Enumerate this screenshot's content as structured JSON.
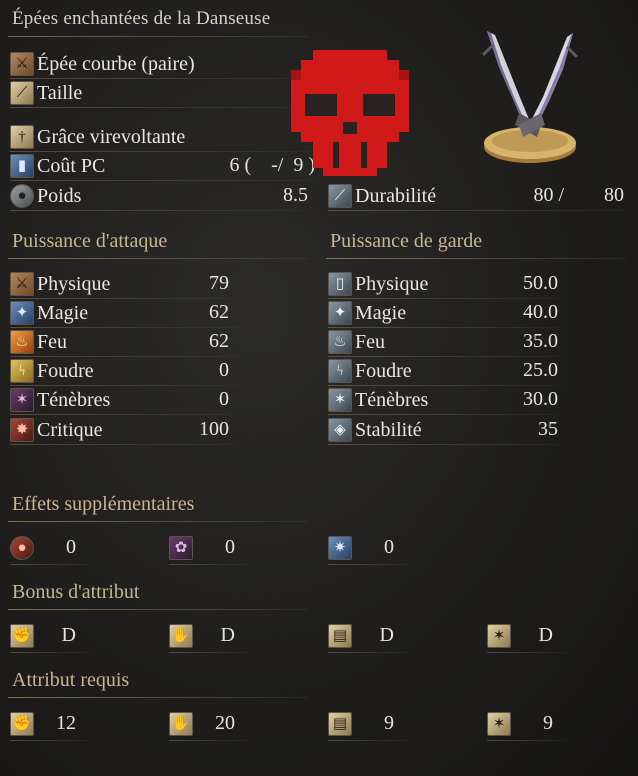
{
  "item": {
    "name": "Épées enchantées de la Danseuse",
    "weapon_type": "Épée courbe (paire)",
    "attack_type": "Taille",
    "skill": "Grâce virevoltante",
    "fp_cost": {
      "label": "Coût PC",
      "value": "6 (    -/  9 )"
    },
    "weight": {
      "label": "Poids",
      "value": "8.5"
    },
    "durability": {
      "label": "Durabilité",
      "current": "80 /",
      "max": "80"
    }
  },
  "attack_power": {
    "heading": "Puissance d'attaque",
    "rows": [
      {
        "label": "Physique",
        "value": "79",
        "icon": "physical-attack-icon"
      },
      {
        "label": "Magie",
        "value": "62",
        "icon": "magic-attack-icon"
      },
      {
        "label": "Feu",
        "value": "62",
        "icon": "fire-attack-icon"
      },
      {
        "label": "Foudre",
        "value": "0",
        "icon": "lightning-attack-icon"
      },
      {
        "label": "Ténèbres",
        "value": "0",
        "icon": "dark-attack-icon"
      },
      {
        "label": "Critique",
        "value": "100",
        "icon": "critical-icon"
      }
    ]
  },
  "guard": {
    "heading": "Puissance de garde",
    "rows": [
      {
        "label": "Physique",
        "value": "50.0",
        "icon": "physical-guard-icon"
      },
      {
        "label": "Magie",
        "value": "40.0",
        "icon": "magic-guard-icon"
      },
      {
        "label": "Feu",
        "value": "35.0",
        "icon": "fire-guard-icon"
      },
      {
        "label": "Foudre",
        "value": "25.0",
        "icon": "lightning-guard-icon"
      },
      {
        "label": "Ténèbres",
        "value": "30.0",
        "icon": "dark-guard-icon"
      },
      {
        "label": "Stabilité",
        "value": "35",
        "icon": "stability-icon"
      }
    ]
  },
  "effects": {
    "heading": "Effets supplémentaires",
    "items": [
      {
        "value": "0",
        "icon": "bleed-icon"
      },
      {
        "value": "0",
        "icon": "poison-icon"
      },
      {
        "value": "0",
        "icon": "frost-icon"
      }
    ]
  },
  "scaling": {
    "heading": "Bonus d'attribut",
    "items": [
      {
        "value": "D",
        "icon": "strength-icon"
      },
      {
        "value": "D",
        "icon": "dexterity-icon"
      },
      {
        "value": "D",
        "icon": "intelligence-icon"
      },
      {
        "value": "D",
        "icon": "faith-icon"
      }
    ]
  },
  "requirements": {
    "heading": "Attribut requis",
    "items": [
      {
        "value": "12",
        "icon": "strength-icon"
      },
      {
        "value": "20",
        "icon": "dexterity-icon"
      },
      {
        "value": "9",
        "icon": "intelligence-icon"
      },
      {
        "value": "9",
        "icon": "faith-icon"
      }
    ]
  }
}
